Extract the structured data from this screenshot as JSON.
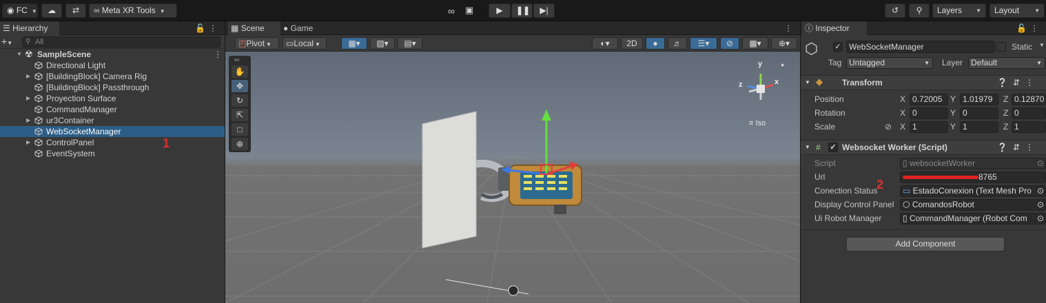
{
  "toolbar": {
    "account_label": "FC",
    "meta_tools_label": "Meta XR Tools",
    "layers_label": "Layers",
    "layout_label": "Layout"
  },
  "hierarchy": {
    "tab_label": "Hierarchy",
    "search_placeholder": "All",
    "scene_name": "SampleScene",
    "items": [
      {
        "label": "Directional Light",
        "expandable": false
      },
      {
        "label": "[BuildingBlock] Camera Rig",
        "expandable": true
      },
      {
        "label": "[BuildingBlock] Passthrough",
        "expandable": false
      },
      {
        "label": "Proyection Surface",
        "expandable": true
      },
      {
        "label": "CommandManager",
        "expandable": false
      },
      {
        "label": "ur3Container",
        "expandable": true
      },
      {
        "label": "WebSocketManager",
        "expandable": false,
        "selected": true
      },
      {
        "label": "ControlPanel",
        "expandable": true
      },
      {
        "label": "EventSystem",
        "expandable": false
      }
    ],
    "annotation": "1"
  },
  "scene": {
    "tabs": [
      "Scene",
      "Game"
    ],
    "pivot_label": "Pivot",
    "local_label": "Local",
    "mode_2d_label": "2D",
    "gizmo_iso_label": "Iso",
    "gizmo_axes": {
      "y": "y",
      "x": "x",
      "z": "z"
    }
  },
  "inspector": {
    "tab_label": "Inspector",
    "object_name": "WebSocketManager",
    "static_label": "Static",
    "tag_label": "Tag",
    "tag_value": "Untagged",
    "layer_label": "Layer",
    "layer_value": "Default",
    "transform": {
      "title": "Transform",
      "position": {
        "label": "Position",
        "x": "0.72005",
        "y": "1.01979",
        "z": "0.12870"
      },
      "rotation": {
        "label": "Rotation",
        "x": "0",
        "y": "0",
        "z": "0"
      },
      "scale": {
        "label": "Scale",
        "x": "1",
        "y": "1",
        "z": "1"
      }
    },
    "script_component": {
      "title": "Websocket Worker (Script)",
      "script": {
        "label": "Script",
        "value": "websocketWorker"
      },
      "url": {
        "label": "Url",
        "value": "8765"
      },
      "conection_status": {
        "label": "Conection Status",
        "value": "EstadoConexion (Text Mesh Pro"
      },
      "display_control_panel": {
        "label": "Display Control Panel",
        "value": "ComandosRobot"
      },
      "ui_robot_manager": {
        "label": "Ui Robot Manager",
        "value": "CommandManager (Robot Com"
      }
    },
    "add_component_label": "Add Component",
    "annotation": "2"
  },
  "colors": {
    "selection": "#2c5d87",
    "panel": "#383838",
    "annotation": "#e03030"
  }
}
